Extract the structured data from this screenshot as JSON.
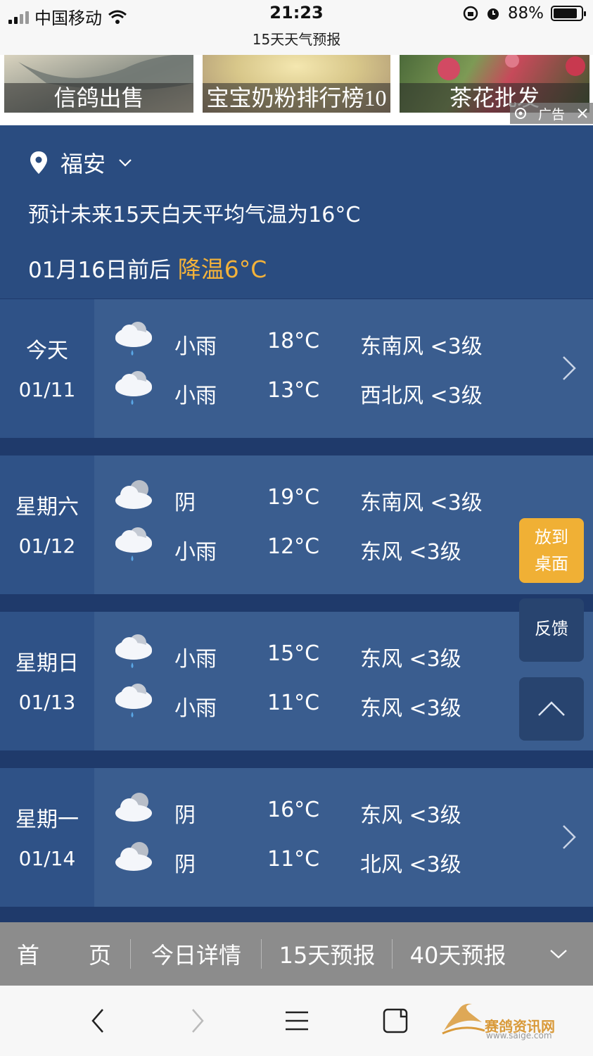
{
  "status_bar": {
    "carrier": "中国移动",
    "time": "21:23",
    "page_title": "15天天气预报",
    "battery": "88%",
    "battery_level": 0.88
  },
  "ads": {
    "items": [
      {
        "label": "信鸽出售"
      },
      {
        "label": "宝宝奶粉排行榜10"
      },
      {
        "label": "茶花批发"
      }
    ],
    "tag": "广告"
  },
  "summary": {
    "location": "福安",
    "average": "预计未来15天白天平均气温为16°C",
    "change_prefix": "01月16日前后",
    "change_highlight": "降温6°C",
    "accent_color": "#f3b23a"
  },
  "days": [
    {
      "name": "今天",
      "date": "01/11",
      "lines": [
        {
          "icon": "rain-cloud-icon",
          "cond": "小雨",
          "temp": "18°C",
          "wind": "东南风 <3级"
        },
        {
          "icon": "rain-cloud-icon",
          "cond": "小雨",
          "temp": "13°C",
          "wind": "西北风 <3级"
        }
      ]
    },
    {
      "name": "星期六",
      "date": "01/12",
      "lines": [
        {
          "icon": "overcast-cloud-icon",
          "cond": "阴",
          "temp": "19°C",
          "wind": "东南风 <3级"
        },
        {
          "icon": "rain-cloud-icon",
          "cond": "小雨",
          "temp": "12°C",
          "wind": "东风 <3级"
        }
      ]
    },
    {
      "name": "星期日",
      "date": "01/13",
      "lines": [
        {
          "icon": "rain-cloud-icon",
          "cond": "小雨",
          "temp": "15°C",
          "wind": "东风 <3级"
        },
        {
          "icon": "rain-cloud-icon",
          "cond": "小雨",
          "temp": "11°C",
          "wind": "东风 <3级"
        }
      ]
    },
    {
      "name": "星期一",
      "date": "01/14",
      "lines": [
        {
          "icon": "overcast-cloud-icon",
          "cond": "阴",
          "temp": "16°C",
          "wind": "东风 <3级"
        },
        {
          "icon": "overcast-cloud-icon",
          "cond": "阴",
          "temp": "11°C",
          "wind": "北风 <3级"
        }
      ]
    }
  ],
  "floating": {
    "desktop_line1": "放到",
    "desktop_line2": "桌面",
    "feedback": "反馈"
  },
  "tabs": {
    "home_1": "首",
    "home_2": "页",
    "today": "今日详情",
    "d15": "15天预报",
    "d40": "40天预报"
  },
  "watermark": {
    "name": "赛鸽资讯网",
    "url": "www.saige.com"
  }
}
